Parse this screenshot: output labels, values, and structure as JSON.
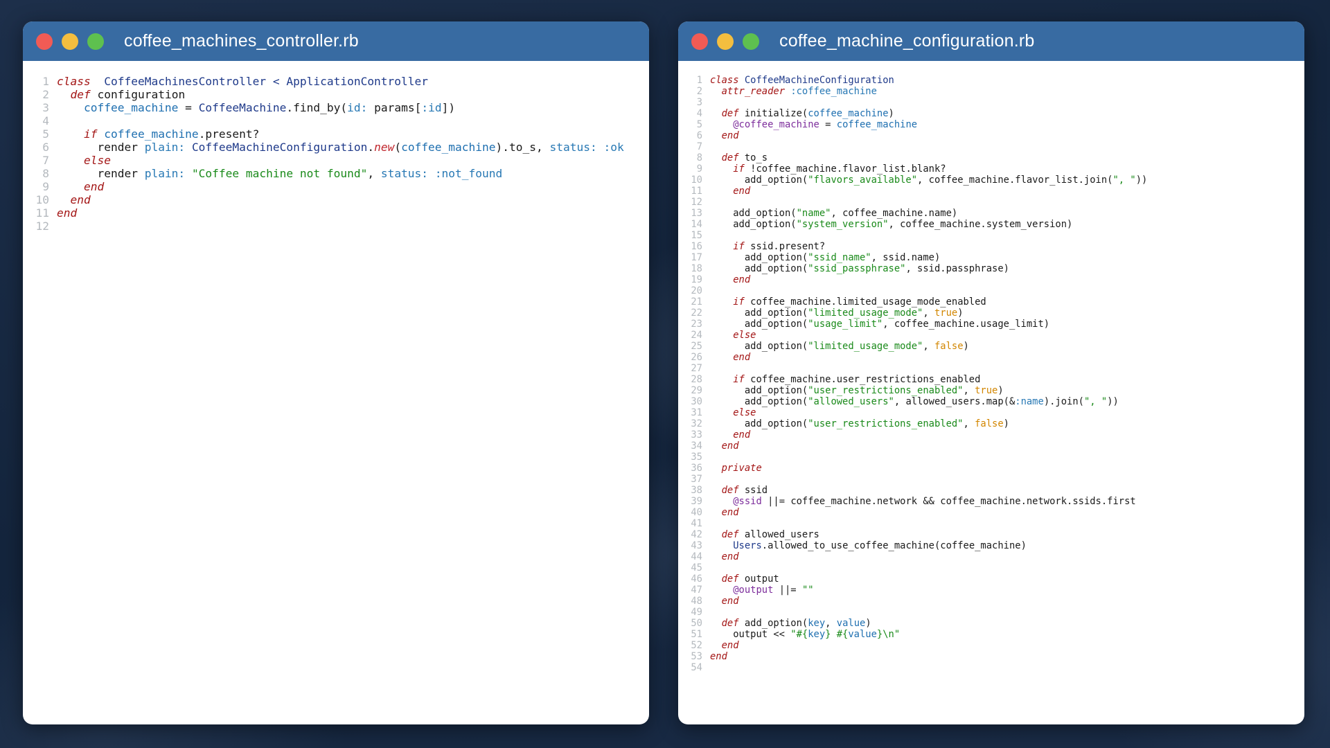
{
  "windows": [
    {
      "title": "coffee_machines_controller.rb",
      "lines": [
        {
          "n": "1",
          "t": [
            [
              "kw",
              "class"
            ],
            [
              "",
              "  "
            ],
            [
              "cls",
              "CoffeeMachinesController < ApplicationController"
            ]
          ]
        },
        {
          "n": "2",
          "t": [
            [
              "",
              "  "
            ],
            [
              "kw",
              "def"
            ],
            [
              "",
              " configuration"
            ]
          ]
        },
        {
          "n": "3",
          "t": [
            [
              "",
              "    "
            ],
            [
              "var",
              "coffee_machine"
            ],
            [
              "",
              " = "
            ],
            [
              "cls",
              "CoffeeMachine"
            ],
            [
              "",
              ".find_by("
            ],
            [
              "sym",
              "id:"
            ],
            [
              "",
              " params["
            ],
            [
              "sym",
              ":id"
            ],
            [
              "",
              "])"
            ]
          ]
        },
        {
          "n": "4",
          "t": []
        },
        {
          "n": "5",
          "t": [
            [
              "",
              "    "
            ],
            [
              "kw",
              "if"
            ],
            [
              "",
              " "
            ],
            [
              "var",
              "coffee_machine"
            ],
            [
              "",
              ".present?"
            ]
          ]
        },
        {
          "n": "6",
          "t": [
            [
              "",
              "      render "
            ],
            [
              "sym",
              "plain:"
            ],
            [
              "",
              " "
            ],
            [
              "cls",
              "CoffeeMachineConfiguration"
            ],
            [
              "",
              "."
            ],
            [
              "meth",
              "new"
            ],
            [
              "",
              "("
            ],
            [
              "var",
              "coffee_machine"
            ],
            [
              "",
              ").to_s, "
            ],
            [
              "sym",
              "status:"
            ],
            [
              "",
              " "
            ],
            [
              "sym",
              ":ok"
            ]
          ]
        },
        {
          "n": "7",
          "t": [
            [
              "",
              "    "
            ],
            [
              "kw",
              "else"
            ]
          ]
        },
        {
          "n": "8",
          "t": [
            [
              "",
              "      render "
            ],
            [
              "sym",
              "plain:"
            ],
            [
              "",
              " "
            ],
            [
              "str",
              "\"Coffee machine not found\""
            ],
            [
              "",
              ", "
            ],
            [
              "sym",
              "status:"
            ],
            [
              "",
              " "
            ],
            [
              "sym",
              ":not_found"
            ]
          ]
        },
        {
          "n": "9",
          "t": [
            [
              "",
              "    "
            ],
            [
              "kw",
              "end"
            ]
          ]
        },
        {
          "n": "10",
          "t": [
            [
              "",
              "  "
            ],
            [
              "kw",
              "end"
            ]
          ]
        },
        {
          "n": "11",
          "t": [
            [
              "kw",
              "end"
            ]
          ]
        },
        {
          "n": "12",
          "t": []
        }
      ]
    },
    {
      "title": "coffee_machine_configuration.rb",
      "lines": [
        {
          "n": "1",
          "t": [
            [
              "kw",
              "class"
            ],
            [
              "",
              " "
            ],
            [
              "cls",
              "CoffeeMachineConfiguration"
            ]
          ]
        },
        {
          "n": "2",
          "t": [
            [
              "",
              "  "
            ],
            [
              "kw",
              "attr_reader"
            ],
            [
              "",
              " "
            ],
            [
              "sym",
              ":coffee_machine"
            ]
          ]
        },
        {
          "n": "3",
          "t": []
        },
        {
          "n": "4",
          "t": [
            [
              "",
              "  "
            ],
            [
              "kw",
              "def"
            ],
            [
              "",
              " initialize("
            ],
            [
              "var",
              "coffee_machine"
            ],
            [
              "",
              ")"
            ]
          ]
        },
        {
          "n": "5",
          "t": [
            [
              "",
              "    "
            ],
            [
              "ivar",
              "@coffee_machine"
            ],
            [
              "",
              " = "
            ],
            [
              "var",
              "coffee_machine"
            ]
          ]
        },
        {
          "n": "6",
          "t": [
            [
              "",
              "  "
            ],
            [
              "kw",
              "end"
            ]
          ]
        },
        {
          "n": "7",
          "t": []
        },
        {
          "n": "8",
          "t": [
            [
              "",
              "  "
            ],
            [
              "kw",
              "def"
            ],
            [
              "",
              " to_s"
            ]
          ]
        },
        {
          "n": "9",
          "t": [
            [
              "",
              "    "
            ],
            [
              "kw",
              "if"
            ],
            [
              "",
              " !coffee_machine.flavor_list.blank?"
            ]
          ]
        },
        {
          "n": "10",
          "t": [
            [
              "",
              "      add_option("
            ],
            [
              "str",
              "\"flavors_available\""
            ],
            [
              "",
              ", coffee_machine.flavor_list.join("
            ],
            [
              "str",
              "\", \""
            ],
            [
              "",
              "))"
            ]
          ]
        },
        {
          "n": "11",
          "t": [
            [
              "",
              "    "
            ],
            [
              "kw",
              "end"
            ]
          ]
        },
        {
          "n": "12",
          "t": []
        },
        {
          "n": "13",
          "t": [
            [
              "",
              "    add_option("
            ],
            [
              "str",
              "\"name\""
            ],
            [
              "",
              ", coffee_machine.name)"
            ]
          ]
        },
        {
          "n": "14",
          "t": [
            [
              "",
              "    add_option("
            ],
            [
              "str",
              "\"system_version\""
            ],
            [
              "",
              ", coffee_machine.system_version)"
            ]
          ]
        },
        {
          "n": "15",
          "t": []
        },
        {
          "n": "16",
          "t": [
            [
              "",
              "    "
            ],
            [
              "kw",
              "if"
            ],
            [
              "",
              " ssid.present?"
            ]
          ]
        },
        {
          "n": "17",
          "t": [
            [
              "",
              "      add_option("
            ],
            [
              "str",
              "\"ssid_name\""
            ],
            [
              "",
              ", ssid.name)"
            ]
          ]
        },
        {
          "n": "18",
          "t": [
            [
              "",
              "      add_option("
            ],
            [
              "str",
              "\"ssid_passphrase\""
            ],
            [
              "",
              ", ssid.passphrase)"
            ]
          ]
        },
        {
          "n": "19",
          "t": [
            [
              "",
              "    "
            ],
            [
              "kw",
              "end"
            ]
          ]
        },
        {
          "n": "20",
          "t": []
        },
        {
          "n": "21",
          "t": [
            [
              "",
              "    "
            ],
            [
              "kw",
              "if"
            ],
            [
              "",
              " coffee_machine.limited_usage_mode_enabled"
            ]
          ]
        },
        {
          "n": "22",
          "t": [
            [
              "",
              "      add_option("
            ],
            [
              "str",
              "\"limited_usage_mode\""
            ],
            [
              "",
              ", "
            ],
            [
              "bool",
              "true"
            ],
            [
              "",
              ")"
            ]
          ]
        },
        {
          "n": "23",
          "t": [
            [
              "",
              "      add_option("
            ],
            [
              "str",
              "\"usage_limit\""
            ],
            [
              "",
              ", coffee_machine.usage_limit)"
            ]
          ]
        },
        {
          "n": "24",
          "t": [
            [
              "",
              "    "
            ],
            [
              "kw",
              "else"
            ]
          ]
        },
        {
          "n": "25",
          "t": [
            [
              "",
              "      add_option("
            ],
            [
              "str",
              "\"limited_usage_mode\""
            ],
            [
              "",
              ", "
            ],
            [
              "bool",
              "false"
            ],
            [
              "",
              ")"
            ]
          ]
        },
        {
          "n": "26",
          "t": [
            [
              "",
              "    "
            ],
            [
              "kw",
              "end"
            ]
          ]
        },
        {
          "n": "27",
          "t": []
        },
        {
          "n": "28",
          "t": [
            [
              "",
              "    "
            ],
            [
              "kw",
              "if"
            ],
            [
              "",
              " coffee_machine.user_restrictions_enabled"
            ]
          ]
        },
        {
          "n": "29",
          "t": [
            [
              "",
              "      add_option("
            ],
            [
              "str",
              "\"user_restrictions_enabled\""
            ],
            [
              "",
              ", "
            ],
            [
              "bool",
              "true"
            ],
            [
              "",
              ")"
            ]
          ]
        },
        {
          "n": "30",
          "t": [
            [
              "",
              "      add_option("
            ],
            [
              "str",
              "\"allowed_users\""
            ],
            [
              "",
              ", allowed_users.map(&"
            ],
            [
              "sym",
              ":name"
            ],
            [
              "",
              ").join("
            ],
            [
              "str",
              "\", \""
            ],
            [
              "",
              "))"
            ]
          ]
        },
        {
          "n": "31",
          "t": [
            [
              "",
              "    "
            ],
            [
              "kw",
              "else"
            ]
          ]
        },
        {
          "n": "32",
          "t": [
            [
              "",
              "      add_option("
            ],
            [
              "str",
              "\"user_restrictions_enabled\""
            ],
            [
              "",
              ", "
            ],
            [
              "bool",
              "false"
            ],
            [
              "",
              ")"
            ]
          ]
        },
        {
          "n": "33",
          "t": [
            [
              "",
              "    "
            ],
            [
              "kw",
              "end"
            ]
          ]
        },
        {
          "n": "34",
          "t": [
            [
              "",
              "  "
            ],
            [
              "kw",
              "end"
            ]
          ]
        },
        {
          "n": "35",
          "t": []
        },
        {
          "n": "36",
          "t": [
            [
              "",
              "  "
            ],
            [
              "kw",
              "private"
            ]
          ]
        },
        {
          "n": "37",
          "t": []
        },
        {
          "n": "38",
          "t": [
            [
              "",
              "  "
            ],
            [
              "kw",
              "def"
            ],
            [
              "",
              " ssid"
            ]
          ]
        },
        {
          "n": "39",
          "t": [
            [
              "",
              "    "
            ],
            [
              "ivar",
              "@ssid"
            ],
            [
              "",
              " ||= coffee_machine.network && coffee_machine.network.ssids.first"
            ]
          ]
        },
        {
          "n": "40",
          "t": [
            [
              "",
              "  "
            ],
            [
              "kw",
              "end"
            ]
          ]
        },
        {
          "n": "41",
          "t": []
        },
        {
          "n": "42",
          "t": [
            [
              "",
              "  "
            ],
            [
              "kw",
              "def"
            ],
            [
              "",
              " allowed_users"
            ]
          ]
        },
        {
          "n": "43",
          "t": [
            [
              "",
              "    "
            ],
            [
              "cls",
              "Users"
            ],
            [
              "",
              ".allowed_to_use_coffee_machine(coffee_machine)"
            ]
          ]
        },
        {
          "n": "44",
          "t": [
            [
              "",
              "  "
            ],
            [
              "kw",
              "end"
            ]
          ]
        },
        {
          "n": "45",
          "t": []
        },
        {
          "n": "46",
          "t": [
            [
              "",
              "  "
            ],
            [
              "kw",
              "def"
            ],
            [
              "",
              " output"
            ]
          ]
        },
        {
          "n": "47",
          "t": [
            [
              "",
              "    "
            ],
            [
              "ivar",
              "@output"
            ],
            [
              "",
              " ||= "
            ],
            [
              "str",
              "\"\""
            ]
          ]
        },
        {
          "n": "48",
          "t": [
            [
              "",
              "  "
            ],
            [
              "kw",
              "end"
            ]
          ]
        },
        {
          "n": "49",
          "t": []
        },
        {
          "n": "50",
          "t": [
            [
              "",
              "  "
            ],
            [
              "kw",
              "def"
            ],
            [
              "",
              " add_option("
            ],
            [
              "var",
              "key"
            ],
            [
              "",
              ", "
            ],
            [
              "var",
              "value"
            ],
            [
              "",
              ")"
            ]
          ]
        },
        {
          "n": "51",
          "t": [
            [
              "",
              "    output << "
            ],
            [
              "str",
              "\"#{"
            ],
            [
              "var",
              "key"
            ],
            [
              "str",
              "} #{"
            ],
            [
              "var",
              "value"
            ],
            [
              "str",
              "}\\n\""
            ]
          ]
        },
        {
          "n": "52",
          "t": [
            [
              "",
              "  "
            ],
            [
              "kw",
              "end"
            ]
          ]
        },
        {
          "n": "53",
          "t": [
            [
              "kw",
              "end"
            ]
          ]
        },
        {
          "n": "54",
          "t": []
        }
      ]
    }
  ],
  "colors": {
    "titlebar": "#386ba2",
    "close": "#f15b55",
    "minimize": "#f4be3f",
    "maximize": "#5ec04f",
    "keyword": "#a31515",
    "class": "#1f3a8a",
    "variable": "#1e6fb0",
    "string": "#1a8a1a",
    "boolean": "#d28600",
    "ivar": "#7d2e9c"
  }
}
